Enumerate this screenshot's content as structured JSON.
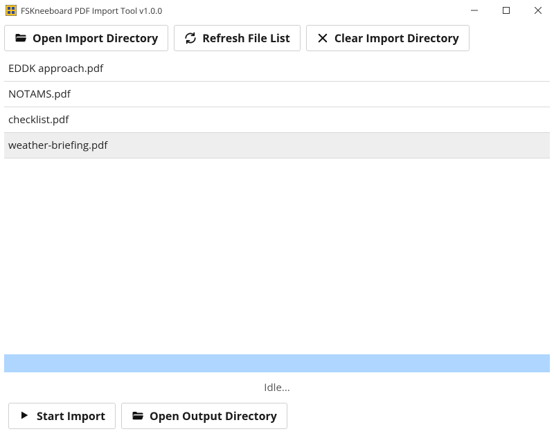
{
  "window": {
    "title": "FSKneeboard PDF Import Tool v1.0.0"
  },
  "toolbar": {
    "open_import_label": "Open Import Directory",
    "refresh_label": "Refresh File List",
    "clear_label": "Clear Import Directory"
  },
  "files": [
    {
      "name": "EDDK approach.pdf",
      "selected": false
    },
    {
      "name": "NOTAMS.pdf",
      "selected": false
    },
    {
      "name": "checklist.pdf",
      "selected": false
    },
    {
      "name": "weather-briefing.pdf",
      "selected": true
    }
  ],
  "status": {
    "text": "Idle..."
  },
  "bottom": {
    "start_label": "Start Import",
    "open_output_label": "Open Output Directory"
  },
  "colors": {
    "progress_fill": "#aed6ff"
  }
}
